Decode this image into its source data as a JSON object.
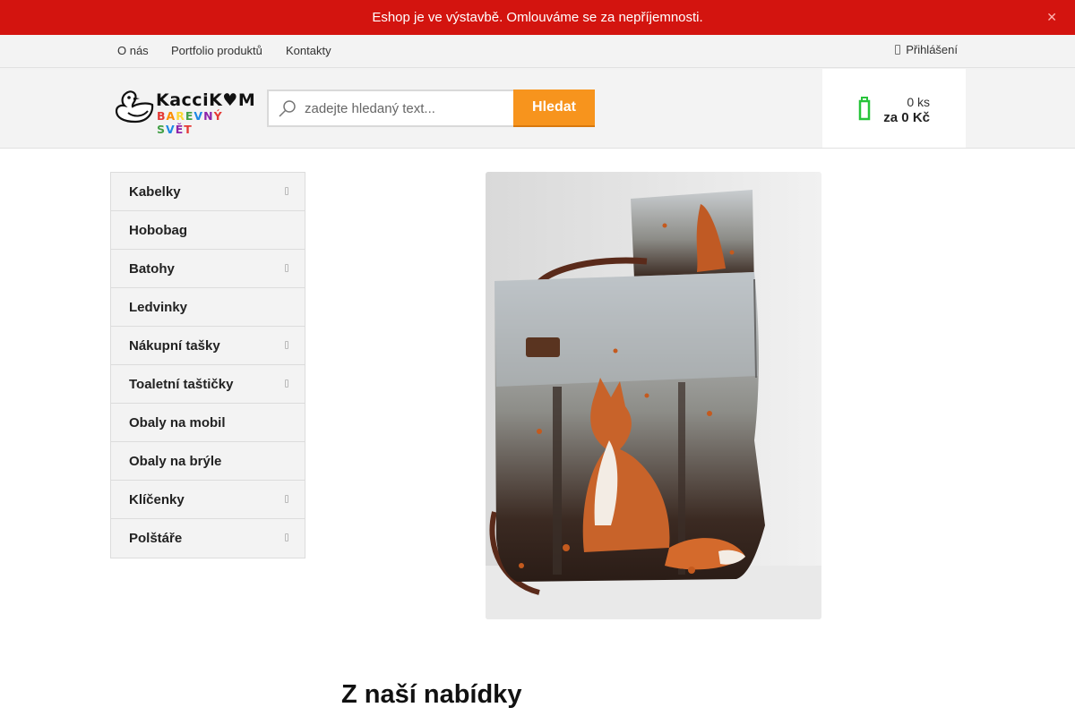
{
  "notice": {
    "text": "Eshop je ve výstavbě. Omlouváme se za nepříjemnosti.",
    "close_icon": "close-icon"
  },
  "top_nav": {
    "links": [
      "O nás",
      "Portfolio produktů",
      "Kontakty"
    ],
    "login_label": "Přihlášení"
  },
  "header": {
    "logo": {
      "name": "KacciK♥M",
      "tagline": "BAREVNÝ SVĚT"
    },
    "search": {
      "placeholder": "zadejte hledaný text...",
      "value": "",
      "button_label": "Hledat"
    },
    "cart": {
      "count": "0 ks",
      "total": "za 0 Kč"
    }
  },
  "sidebar": {
    "items": [
      {
        "label": "Kabelky",
        "has_submenu": true
      },
      {
        "label": "Hobobag",
        "has_submenu": false
      },
      {
        "label": "Batohy",
        "has_submenu": true
      },
      {
        "label": "Ledvinky",
        "has_submenu": false
      },
      {
        "label": "Nákupní tašky",
        "has_submenu": true
      },
      {
        "label": "Toaletní taštičky",
        "has_submenu": true
      },
      {
        "label": "Obaly na mobil",
        "has_submenu": false
      },
      {
        "label": "Obaly na brýle",
        "has_submenu": false
      },
      {
        "label": "Klíčenky",
        "has_submenu": true
      },
      {
        "label": "Polštáře",
        "has_submenu": true
      }
    ]
  },
  "main": {
    "section_title": "Z naší nabídky"
  },
  "colors": {
    "notice_bg": "#d3140f",
    "accent": "#f7941d",
    "cart_icon": "#27c43a"
  }
}
